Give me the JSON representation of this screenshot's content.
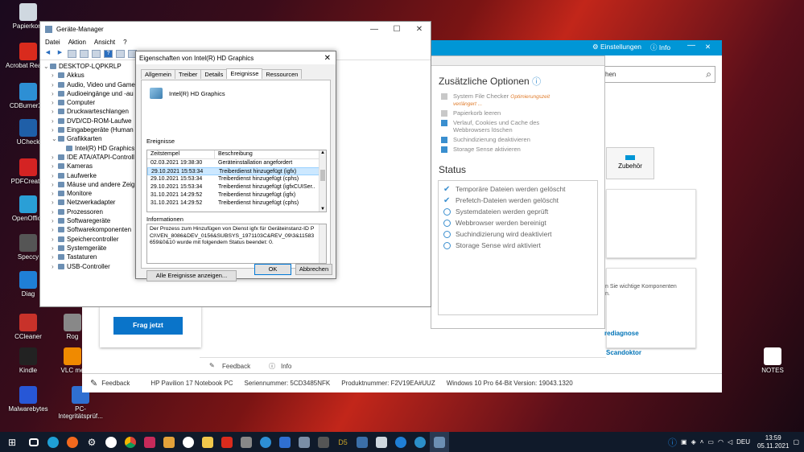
{
  "desktop_icons": [
    {
      "label": "Papierkorb",
      "icon": "recycle-bin-icon"
    },
    {
      "label": "Acrobat Reader",
      "icon": "acrobat-icon"
    },
    {
      "label": "CDBurnerXP",
      "icon": "cdburner-icon"
    },
    {
      "label": "UCheck",
      "icon": "ucheck-icon"
    },
    {
      "label": "PDFCreator",
      "icon": "pdfcreator-icon"
    },
    {
      "label": "OpenOffice",
      "icon": "openoffice-icon"
    },
    {
      "label": "Speccy",
      "icon": "speccy-icon"
    },
    {
      "label": "Diag",
      "icon": "diag-icon"
    },
    {
      "label": "CCleaner",
      "icon": "ccleaner-icon"
    },
    {
      "label": "Kindle",
      "icon": "kindle-icon"
    },
    {
      "label": "Malwarebytes",
      "icon": "malwarebytes-icon"
    },
    {
      "label": "VLC me",
      "icon": "vlc-icon"
    },
    {
      "label": "PC-Integritätsprüf...",
      "icon": "pc-health-icon"
    },
    {
      "label": "NOTES",
      "icon": "notes-icon"
    },
    {
      "label": "Rog",
      "icon": "app-icon"
    }
  ],
  "device_manager": {
    "title": "Geräte-Manager",
    "menu": [
      "Datei",
      "Aktion",
      "Ansicht",
      "?"
    ],
    "tree": [
      {
        "label": "DESKTOP-LQPKRLP",
        "level": 0,
        "expanded": true
      },
      {
        "label": "Akkus",
        "level": 1
      },
      {
        "label": "Audio, Video und Game",
        "level": 1
      },
      {
        "label": "Audioeingänge und -au",
        "level": 1
      },
      {
        "label": "Computer",
        "level": 1
      },
      {
        "label": "Druckwarteschlangen",
        "level": 1
      },
      {
        "label": "DVD/CD-ROM-Laufwe",
        "level": 1
      },
      {
        "label": "Eingabegeräte (Human",
        "level": 1
      },
      {
        "label": "Grafikkarten",
        "level": 1,
        "expanded": true
      },
      {
        "label": "Intel(R) HD Graphics",
        "level": 2
      },
      {
        "label": "IDE ATA/ATAPI-Controll",
        "level": 1
      },
      {
        "label": "Kameras",
        "level": 1
      },
      {
        "label": "Laufwerke",
        "level": 1
      },
      {
        "label": "Mäuse und andere Zeig",
        "level": 1
      },
      {
        "label": "Monitore",
        "level": 1
      },
      {
        "label": "Netzwerkadapter",
        "level": 1
      },
      {
        "label": "Prozessoren",
        "level": 1
      },
      {
        "label": "Softwaregeräte",
        "level": 1
      },
      {
        "label": "Softwarekomponenten",
        "level": 1
      },
      {
        "label": "Speichercontroller",
        "level": 1
      },
      {
        "label": "Systemgeräte",
        "level": 1
      },
      {
        "label": "Tastaturen",
        "level": 1
      },
      {
        "label": "USB-Controller",
        "level": 1
      }
    ]
  },
  "dialog": {
    "title": "Eigenschaften von Intel(R) HD Graphics",
    "tabs": [
      "Allgemein",
      "Treiber",
      "Details",
      "Ereignisse",
      "Ressourcen"
    ],
    "active_tab": 3,
    "device_name": "Intel(R) HD Graphics",
    "events_label": "Ereignisse",
    "col_time": "Zeitstempel",
    "col_desc": "Beschreibung",
    "events": [
      {
        "time": "02.03.2021 19:38:30",
        "desc": "Geräteinstallation angefordert"
      },
      {
        "time": "29.10.2021 15:53:34",
        "desc": "Treiberdienst hinzugefügt (igfx)",
        "selected": true
      },
      {
        "time": "29.10.2021 15:53:34",
        "desc": "Treiberdienst hinzugefügt (cphs)"
      },
      {
        "time": "29.10.2021 15:53:34",
        "desc": "Treiberdienst hinzugefügt (igfxCUISer..."
      },
      {
        "time": "31.10.2021 14:29:52",
        "desc": "Treiberdienst hinzugefügt (igfx)"
      },
      {
        "time": "31.10.2021 14:29:52",
        "desc": "Treiberdienst hinzugefügt (cphs)"
      }
    ],
    "info_label": "Informationen",
    "info_text": "Der Prozess zum Hinzufügen von Dienst igfx für Geräteinstanz-ID PCI\\VEN_8086&DEV_0156&SUBSYS_1971103C&REV_09\\3&11583659&0&10 wurde mit folgendem Status beendet: 0.",
    "all_events_button": "Alle Ereignisse anzeigen...",
    "ok_button": "OK",
    "cancel_button": "Abbrechen"
  },
  "hp_support": {
    "header_items": [
      "Einstellungen",
      "Info"
    ],
    "search_placeholder": "hen",
    "frag_button": "Frag jetzt",
    "zubehoer": "Zubehör",
    "side_text": "n Sie wichtige Komponenten",
    "side_text2": "n.",
    "link1": "rediagnose",
    "link2": "Scandoktor",
    "inner_feedback": "Feedback",
    "inner_info": "Info",
    "footer": {
      "feedback": "Feedback",
      "model": "HP Pavilion 17 Notebook PC",
      "serial": "Seriennummer: 5CD3485NFK",
      "product": "Produktnummer: F2V19EA#UUZ",
      "os": "Windows 10 Pro 64-Bit Version: 19043.1320"
    }
  },
  "optimizer": {
    "title": "Zusätzliche Optionen",
    "options": [
      {
        "label": "System File Checker",
        "note": "Optimierungszeit verlängert ...",
        "checked": false
      },
      {
        "label": "Papierkorb leeren",
        "checked": false
      },
      {
        "label": "Verlauf, Cookies und Cache des Webbrowsers löschen",
        "checked": true
      },
      {
        "label": "Suchindizierung deaktivieren",
        "checked": true
      },
      {
        "label": "Storage Sense aktivieren",
        "checked": true
      }
    ],
    "status_title": "Status",
    "status_items": [
      {
        "label": "Temporäre Dateien werden gelöscht",
        "done": true
      },
      {
        "label": "Prefetch-Dateien werden gelöscht",
        "done": true
      },
      {
        "label": "Systemdateien werden geprüft",
        "done": false
      },
      {
        "label": "Webbrowser werden bereinigt",
        "done": false
      },
      {
        "label": "Suchindizierung wird deaktiviert",
        "done": false
      },
      {
        "label": "Storage Sense wird aktiviert",
        "done": false
      }
    ]
  },
  "taskbar": {
    "clock_time": "13:59",
    "clock_date": "05.11.2021",
    "language": "DEU"
  },
  "colors": {
    "accent": "#0096d6",
    "frag_button": "#0a74c9",
    "dlg_accent": "#0078d7"
  }
}
